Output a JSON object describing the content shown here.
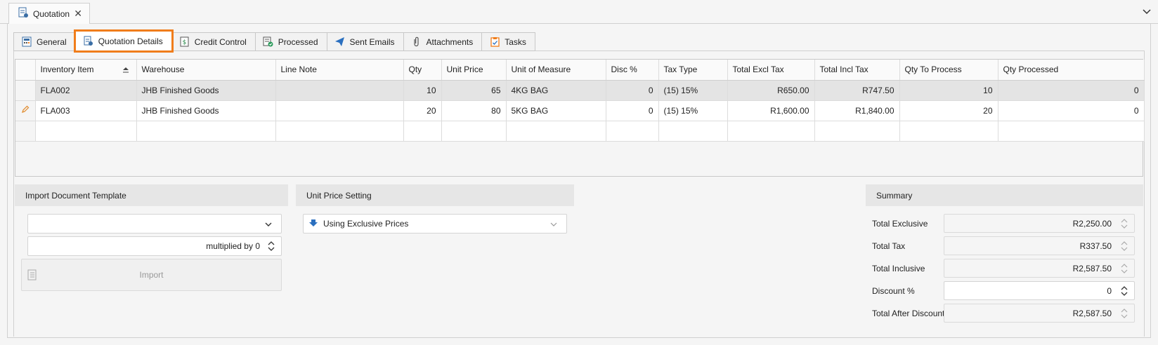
{
  "document_tab": {
    "label": "Quotation"
  },
  "subtabs": [
    {
      "label": "General",
      "icon": "calculator-icon"
    },
    {
      "label": "Quotation Details",
      "icon": "document-details-icon",
      "active": true
    },
    {
      "label": "Credit Control",
      "icon": "credit-control-icon"
    },
    {
      "label": "Processed",
      "icon": "processed-check-icon"
    },
    {
      "label": "Sent Emails",
      "icon": "paper-plane-icon"
    },
    {
      "label": "Attachments",
      "icon": "paperclip-icon"
    },
    {
      "label": "Tasks",
      "icon": "clipboard-icon"
    }
  ],
  "grid": {
    "columns": [
      "Inventory Item",
      "Warehouse",
      "Line Note",
      "Qty",
      "Unit Price",
      "Unit of Measure",
      "Disc %",
      "Tax Type",
      "Total Excl Tax",
      "Total Incl Tax",
      "Qty To Process",
      "Qty Processed"
    ],
    "rows": [
      [
        "FLA002",
        "JHB Finished Goods",
        "",
        "10",
        "65",
        "4KG BAG",
        "0",
        "(15) 15%",
        "R650.00",
        "R747.50",
        "10",
        "0"
      ],
      [
        "FLA003",
        "JHB Finished Goods",
        "",
        "20",
        "80",
        "5KG BAG",
        "0",
        "(15) 15%",
        "R1,600.00",
        "R1,840.00",
        "20",
        "0"
      ]
    ]
  },
  "import_template": {
    "header": "Import Document Template",
    "template_value": "",
    "multiplier_text": "multiplied by 0",
    "import_label": "Import"
  },
  "unit_price": {
    "header": "Unit Price Setting",
    "value": "Using Exclusive Prices"
  },
  "summary": {
    "header": "Summary",
    "rows": [
      {
        "label": "Total Exclusive",
        "value": "R2,250.00"
      },
      {
        "label": "Total Tax",
        "value": "R337.50"
      },
      {
        "label": "Total Inclusive",
        "value": "R2,587.50"
      },
      {
        "label": "Discount %",
        "value": "0"
      },
      {
        "label": "Total After Discount",
        "value": "R2,587.50"
      }
    ]
  },
  "colors": {
    "active_tab_outline": "#f07d1b",
    "selected_row": "#e4e4e4",
    "section_header": "#e6e6e6"
  }
}
